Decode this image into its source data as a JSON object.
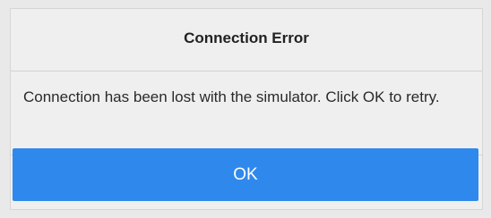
{
  "dialog": {
    "title": "Connection Error",
    "message": "Connection has been lost with the simulator. Click OK to retry.",
    "ok_label": "OK"
  },
  "colors": {
    "button_bg": "#2f89ec",
    "dialog_bg": "#efefef",
    "page_bg": "#e9e9e9"
  }
}
